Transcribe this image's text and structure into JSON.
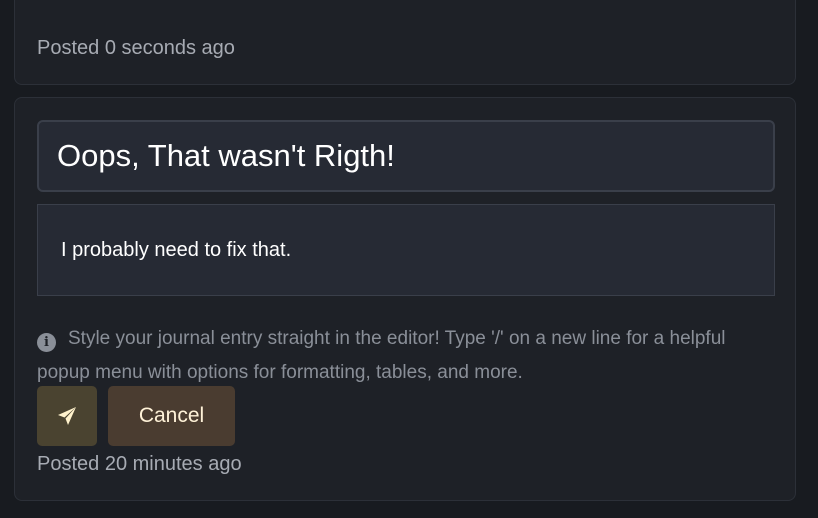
{
  "previous_entry": {
    "posted": "Posted 0 seconds ago"
  },
  "edit_entry": {
    "title_value": "Oops, That wasn't Rigth!",
    "body_value": "I probably need to fix that.",
    "help_text": "Style your journal entry straight in the editor! Type '/' on a new line for a helpful popup menu with options for formatting, tables, and more.",
    "submit_icon": "paper-plane-icon",
    "cancel_label": "Cancel",
    "posted": "Posted 20 minutes ago"
  },
  "colors": {
    "background": "#181b20",
    "card": "#1e2127",
    "input": "#262a34",
    "submit_button": "#4a4330",
    "cancel_button": "#4a3c30"
  }
}
